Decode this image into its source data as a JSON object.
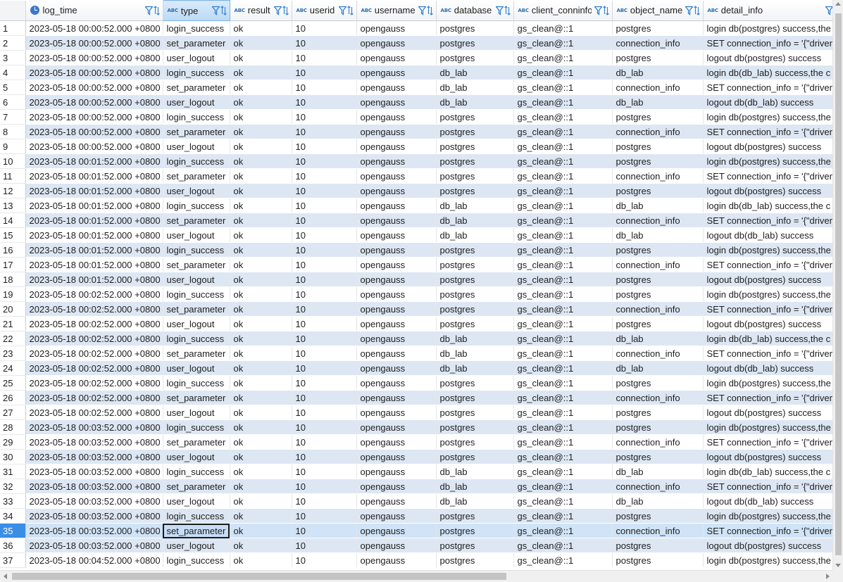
{
  "grid": {
    "type_badge": "ABC",
    "selected_row": 35,
    "selected_column": "type",
    "columns": [
      {
        "key": "log_time",
        "label": "log_time",
        "kind": "timestamp"
      },
      {
        "key": "type",
        "label": "type",
        "kind": "text"
      },
      {
        "key": "result",
        "label": "result",
        "kind": "text"
      },
      {
        "key": "userid",
        "label": "userid",
        "kind": "text"
      },
      {
        "key": "username",
        "label": "username",
        "kind": "text"
      },
      {
        "key": "database",
        "label": "database",
        "kind": "text"
      },
      {
        "key": "client_conninfo",
        "label": "client_conninfo",
        "kind": "text"
      },
      {
        "key": "object_name",
        "label": "object_name",
        "kind": "text"
      },
      {
        "key": "detail_info",
        "label": "detail_info",
        "kind": "text"
      }
    ],
    "rows": [
      [
        "1",
        "2023-05-18 00:00:52.000 +0800",
        "login_success",
        "ok",
        "10",
        "opengauss",
        "postgres",
        "gs_clean@::1",
        "postgres",
        "login db(postgres) success,the"
      ],
      [
        "2",
        "2023-05-18 00:00:52.000 +0800",
        "set_parameter",
        "ok",
        "10",
        "opengauss",
        "postgres",
        "gs_clean@::1",
        "connection_info",
        "SET connection_info = '{\"driver"
      ],
      [
        "3",
        "2023-05-18 00:00:52.000 +0800",
        "user_logout",
        "ok",
        "10",
        "opengauss",
        "postgres",
        "gs_clean@::1",
        "postgres",
        "logout db(postgres) success"
      ],
      [
        "4",
        "2023-05-18 00:00:52.000 +0800",
        "login_success",
        "ok",
        "10",
        "opengauss",
        "db_lab",
        "gs_clean@::1",
        "db_lab",
        "login db(db_lab) success,the c"
      ],
      [
        "5",
        "2023-05-18 00:00:52.000 +0800",
        "set_parameter",
        "ok",
        "10",
        "opengauss",
        "db_lab",
        "gs_clean@::1",
        "connection_info",
        "SET connection_info = '{\"driver"
      ],
      [
        "6",
        "2023-05-18 00:00:52.000 +0800",
        "user_logout",
        "ok",
        "10",
        "opengauss",
        "db_lab",
        "gs_clean@::1",
        "db_lab",
        "logout db(db_lab) success"
      ],
      [
        "7",
        "2023-05-18 00:00:52.000 +0800",
        "login_success",
        "ok",
        "10",
        "opengauss",
        "postgres",
        "gs_clean@::1",
        "postgres",
        "login db(postgres) success,the"
      ],
      [
        "8",
        "2023-05-18 00:00:52.000 +0800",
        "set_parameter",
        "ok",
        "10",
        "opengauss",
        "postgres",
        "gs_clean@::1",
        "connection_info",
        "SET connection_info = '{\"driver"
      ],
      [
        "9",
        "2023-05-18 00:00:52.000 +0800",
        "user_logout",
        "ok",
        "10",
        "opengauss",
        "postgres",
        "gs_clean@::1",
        "postgres",
        "logout db(postgres) success"
      ],
      [
        "10",
        "2023-05-18 00:01:52.000 +0800",
        "login_success",
        "ok",
        "10",
        "opengauss",
        "postgres",
        "gs_clean@::1",
        "postgres",
        "login db(postgres) success,the"
      ],
      [
        "11",
        "2023-05-18 00:01:52.000 +0800",
        "set_parameter",
        "ok",
        "10",
        "opengauss",
        "postgres",
        "gs_clean@::1",
        "connection_info",
        "SET connection_info = '{\"driver"
      ],
      [
        "12",
        "2023-05-18 00:01:52.000 +0800",
        "user_logout",
        "ok",
        "10",
        "opengauss",
        "postgres",
        "gs_clean@::1",
        "postgres",
        "logout db(postgres) success"
      ],
      [
        "13",
        "2023-05-18 00:01:52.000 +0800",
        "login_success",
        "ok",
        "10",
        "opengauss",
        "db_lab",
        "gs_clean@::1",
        "db_lab",
        "login db(db_lab) success,the c"
      ],
      [
        "14",
        "2023-05-18 00:01:52.000 +0800",
        "set_parameter",
        "ok",
        "10",
        "opengauss",
        "db_lab",
        "gs_clean@::1",
        "connection_info",
        "SET connection_info = '{\"driver"
      ],
      [
        "15",
        "2023-05-18 00:01:52.000 +0800",
        "user_logout",
        "ok",
        "10",
        "opengauss",
        "db_lab",
        "gs_clean@::1",
        "db_lab",
        "logout db(db_lab) success"
      ],
      [
        "16",
        "2023-05-18 00:01:52.000 +0800",
        "login_success",
        "ok",
        "10",
        "opengauss",
        "postgres",
        "gs_clean@::1",
        "postgres",
        "login db(postgres) success,the"
      ],
      [
        "17",
        "2023-05-18 00:01:52.000 +0800",
        "set_parameter",
        "ok",
        "10",
        "opengauss",
        "postgres",
        "gs_clean@::1",
        "connection_info",
        "SET connection_info = '{\"driver"
      ],
      [
        "18",
        "2023-05-18 00:01:52.000 +0800",
        "user_logout",
        "ok",
        "10",
        "opengauss",
        "postgres",
        "gs_clean@::1",
        "postgres",
        "logout db(postgres) success"
      ],
      [
        "19",
        "2023-05-18 00:02:52.000 +0800",
        "login_success",
        "ok",
        "10",
        "opengauss",
        "postgres",
        "gs_clean@::1",
        "postgres",
        "login db(postgres) success,the"
      ],
      [
        "20",
        "2023-05-18 00:02:52.000 +0800",
        "set_parameter",
        "ok",
        "10",
        "opengauss",
        "postgres",
        "gs_clean@::1",
        "connection_info",
        "SET connection_info = '{\"driver"
      ],
      [
        "21",
        "2023-05-18 00:02:52.000 +0800",
        "user_logout",
        "ok",
        "10",
        "opengauss",
        "postgres",
        "gs_clean@::1",
        "postgres",
        "logout db(postgres) success"
      ],
      [
        "22",
        "2023-05-18 00:02:52.000 +0800",
        "login_success",
        "ok",
        "10",
        "opengauss",
        "db_lab",
        "gs_clean@::1",
        "db_lab",
        "login db(db_lab) success,the c"
      ],
      [
        "23",
        "2023-05-18 00:02:52.000 +0800",
        "set_parameter",
        "ok",
        "10",
        "opengauss",
        "db_lab",
        "gs_clean@::1",
        "connection_info",
        "SET connection_info = '{\"driver"
      ],
      [
        "24",
        "2023-05-18 00:02:52.000 +0800",
        "user_logout",
        "ok",
        "10",
        "opengauss",
        "db_lab",
        "gs_clean@::1",
        "db_lab",
        "logout db(db_lab) success"
      ],
      [
        "25",
        "2023-05-18 00:02:52.000 +0800",
        "login_success",
        "ok",
        "10",
        "opengauss",
        "postgres",
        "gs_clean@::1",
        "postgres",
        "login db(postgres) success,the"
      ],
      [
        "26",
        "2023-05-18 00:02:52.000 +0800",
        "set_parameter",
        "ok",
        "10",
        "opengauss",
        "postgres",
        "gs_clean@::1",
        "connection_info",
        "SET connection_info = '{\"driver"
      ],
      [
        "27",
        "2023-05-18 00:02:52.000 +0800",
        "user_logout",
        "ok",
        "10",
        "opengauss",
        "postgres",
        "gs_clean@::1",
        "postgres",
        "logout db(postgres) success"
      ],
      [
        "28",
        "2023-05-18 00:03:52.000 +0800",
        "login_success",
        "ok",
        "10",
        "opengauss",
        "postgres",
        "gs_clean@::1",
        "postgres",
        "login db(postgres) success,the"
      ],
      [
        "29",
        "2023-05-18 00:03:52.000 +0800",
        "set_parameter",
        "ok",
        "10",
        "opengauss",
        "postgres",
        "gs_clean@::1",
        "connection_info",
        "SET connection_info = '{\"driver"
      ],
      [
        "30",
        "2023-05-18 00:03:52.000 +0800",
        "user_logout",
        "ok",
        "10",
        "opengauss",
        "postgres",
        "gs_clean@::1",
        "postgres",
        "logout db(postgres) success"
      ],
      [
        "31",
        "2023-05-18 00:03:52.000 +0800",
        "login_success",
        "ok",
        "10",
        "opengauss",
        "db_lab",
        "gs_clean@::1",
        "db_lab",
        "login db(db_lab) success,the c"
      ],
      [
        "32",
        "2023-05-18 00:03:52.000 +0800",
        "set_parameter",
        "ok",
        "10",
        "opengauss",
        "db_lab",
        "gs_clean@::1",
        "connection_info",
        "SET connection_info = '{\"driver"
      ],
      [
        "33",
        "2023-05-18 00:03:52.000 +0800",
        "user_logout",
        "ok",
        "10",
        "opengauss",
        "db_lab",
        "gs_clean@::1",
        "db_lab",
        "logout db(db_lab) success"
      ],
      [
        "34",
        "2023-05-18 00:03:52.000 +0800",
        "login_success",
        "ok",
        "10",
        "opengauss",
        "postgres",
        "gs_clean@::1",
        "postgres",
        "login db(postgres) success,the"
      ],
      [
        "35",
        "2023-05-18 00:03:52.000 +0800",
        "set_parameter",
        "ok",
        "10",
        "opengauss",
        "postgres",
        "gs_clean@::1",
        "connection_info",
        "SET connection_info = '{\"driver"
      ],
      [
        "36",
        "2023-05-18 00:03:52.000 +0800",
        "user_logout",
        "ok",
        "10",
        "opengauss",
        "postgres",
        "gs_clean@::1",
        "postgres",
        "logout db(postgres) success"
      ],
      [
        "37",
        "2023-05-18 00:04:52.000 +0800",
        "login_success",
        "ok",
        "10",
        "opengauss",
        "postgres",
        "gs_clean@::1",
        "postgres",
        "login db(postgres) success,the"
      ]
    ]
  },
  "colors": {
    "row_alt": "#dde7f3",
    "row_selected": "#d0e3f7",
    "row_number_selected": "#3a8ee6",
    "header_selected": "#bcd9f4",
    "accent_icon": "#2f7fd0"
  },
  "icons": {
    "timestamp_column": "clock-icon",
    "text_column": "abc-type-icon",
    "filter": "filter-icon",
    "sort": "sort-icon"
  }
}
